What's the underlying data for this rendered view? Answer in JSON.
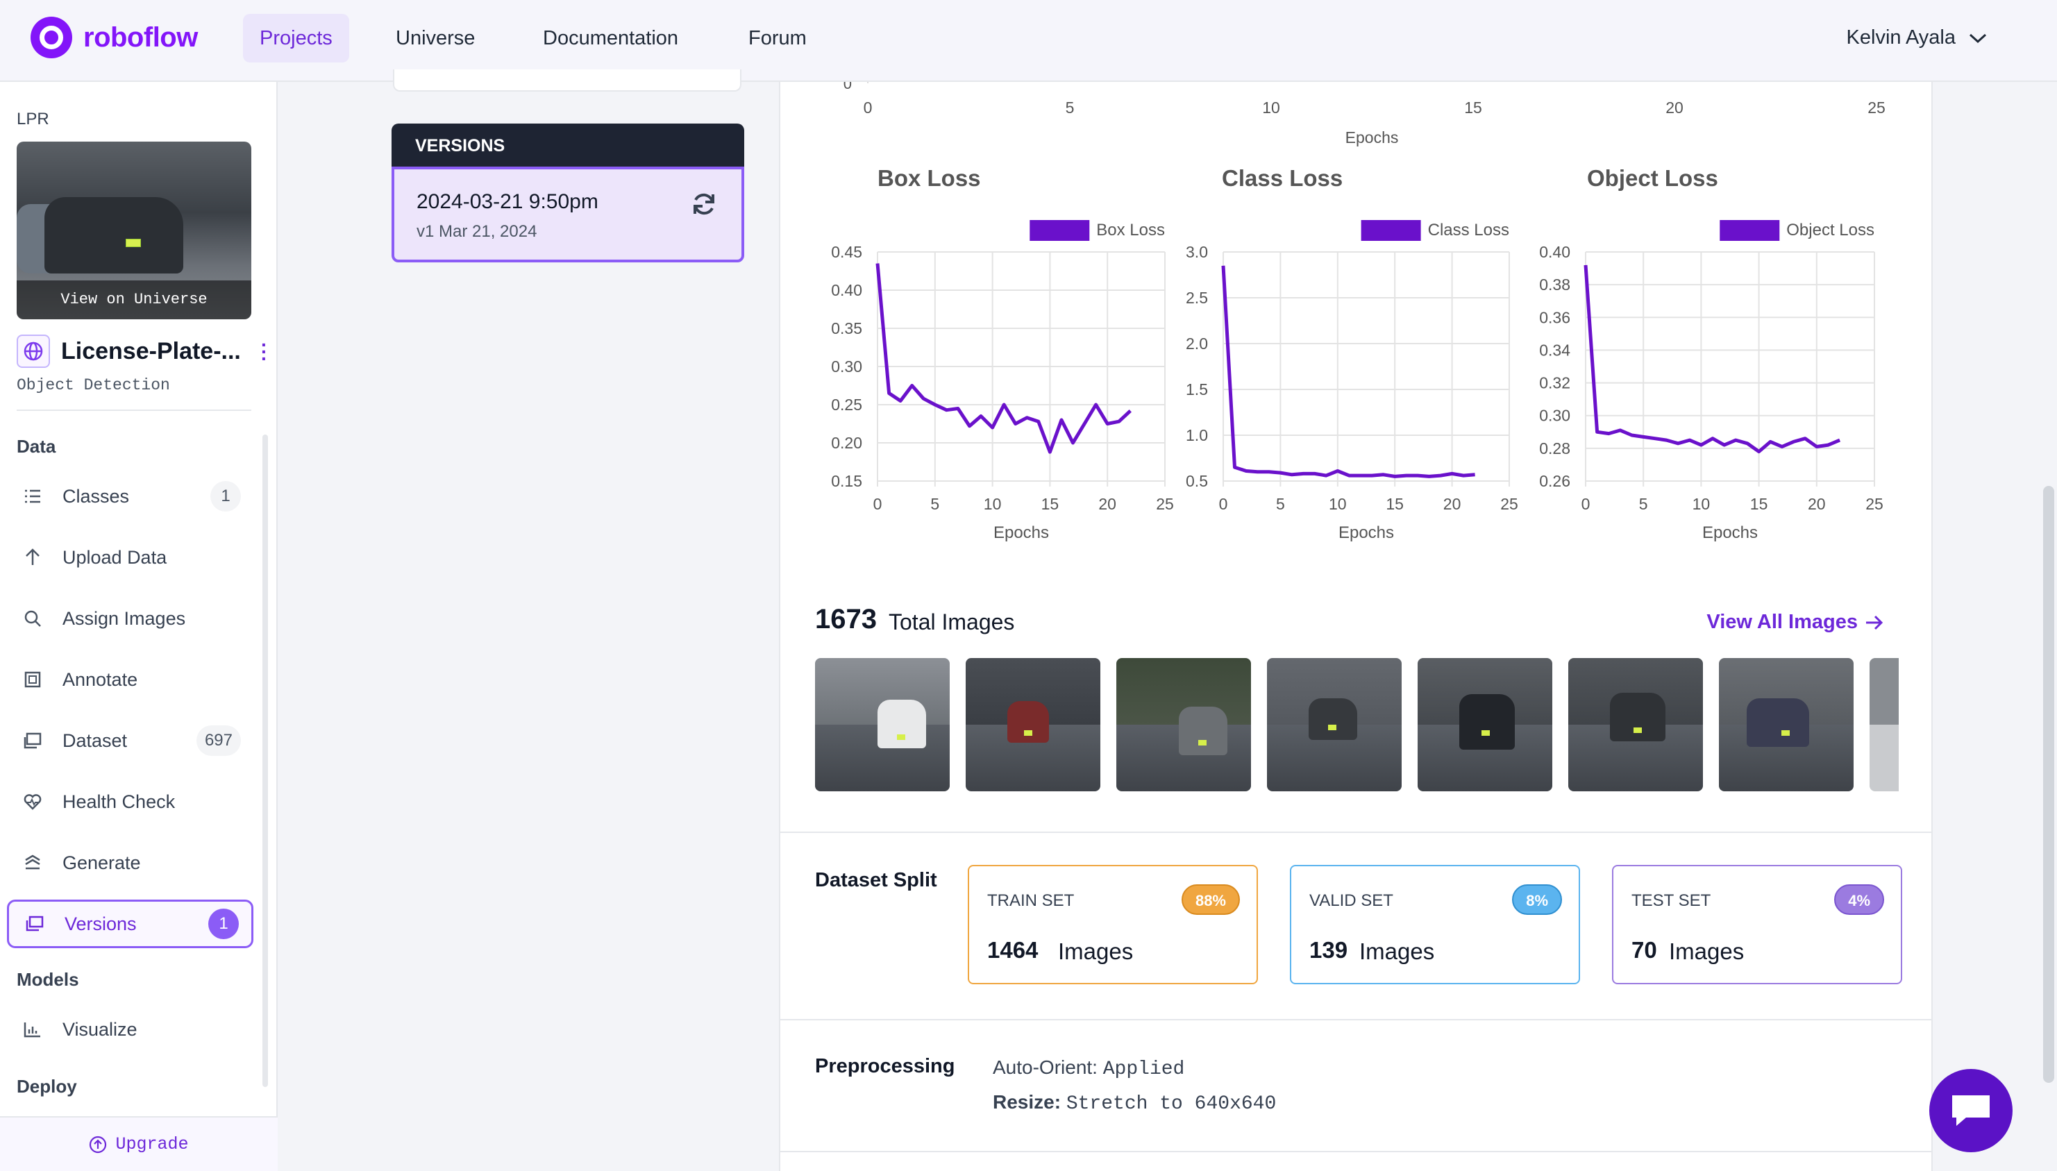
{
  "nav": {
    "brand": "roboflow",
    "links": [
      "Projects",
      "Universe",
      "Documentation",
      "Forum"
    ],
    "user": "Kelvin Ayala"
  },
  "sidebar": {
    "project_code": "LPR",
    "thumb_label": "View on Universe",
    "project_name": "License-Plate-...",
    "project_type": "Object Detection",
    "section_data": "Data",
    "items": [
      {
        "label": "Classes",
        "count": "1",
        "icon": "list-icon"
      },
      {
        "label": "Upload Data",
        "icon": "upload-icon"
      },
      {
        "label": "Assign Images",
        "icon": "search-icon"
      },
      {
        "label": "Annotate",
        "icon": "annotate-icon"
      },
      {
        "label": "Dataset",
        "count": "697",
        "icon": "dataset-icon"
      },
      {
        "label": "Health Check",
        "icon": "heart-pulse-icon"
      },
      {
        "label": "Generate",
        "icon": "generate-icon"
      },
      {
        "label": "Versions",
        "count": "1",
        "icon": "versions-icon"
      }
    ],
    "section_models": "Models",
    "visualize": "Visualize",
    "section_deploy": "Deploy",
    "upgrade": "Upgrade"
  },
  "versions": {
    "header": "VERSIONS",
    "name": "2024-03-21 9:50pm",
    "sub": "v1 Mar 21, 2024"
  },
  "top_chart": {
    "x_ticks": [
      "0",
      "5",
      "10",
      "15",
      "20",
      "25"
    ],
    "y_tick": "0",
    "xlabel": "Epochs"
  },
  "chart_data": [
    {
      "type": "line",
      "title": "Box Loss",
      "legend": "Box Loss",
      "xlabel": "Epochs",
      "ylim": [
        0.15,
        0.45
      ],
      "y_ticks": [
        "0.45",
        "0.40",
        "0.35",
        "0.30",
        "0.25",
        "0.20",
        "0.15"
      ],
      "y_tick_values": [
        0.45,
        0.4,
        0.35,
        0.3,
        0.25,
        0.2,
        0.15
      ],
      "x_ticks": [
        "0",
        "5",
        "10",
        "15",
        "20",
        "25"
      ],
      "xlim": [
        0,
        25
      ],
      "x": [
        0,
        1,
        2,
        3,
        4,
        5,
        6,
        7,
        8,
        9,
        10,
        11,
        12,
        13,
        14,
        15,
        16,
        17,
        18,
        19,
        20,
        21,
        22
      ],
      "y": [
        0.435,
        0.265,
        0.255,
        0.275,
        0.258,
        0.25,
        0.243,
        0.245,
        0.222,
        0.235,
        0.22,
        0.25,
        0.225,
        0.233,
        0.228,
        0.188,
        0.23,
        0.2,
        0.225,
        0.25,
        0.225,
        0.228,
        0.242
      ]
    },
    {
      "type": "line",
      "title": "Class Loss",
      "legend": "Class Loss",
      "xlabel": "Epochs",
      "ylim": [
        0.5,
        3.0
      ],
      "y_ticks": [
        "3.0",
        "2.5",
        "2.0",
        "1.5",
        "1.0",
        "0.5"
      ],
      "y_tick_values": [
        3.0,
        2.5,
        2.0,
        1.5,
        1.0,
        0.5
      ],
      "x_ticks": [
        "0",
        "5",
        "10",
        "15",
        "20",
        "25"
      ],
      "xlim": [
        0,
        25
      ],
      "x": [
        0,
        1,
        2,
        3,
        4,
        5,
        6,
        7,
        8,
        9,
        10,
        11,
        12,
        13,
        14,
        15,
        16,
        17,
        18,
        19,
        20,
        21,
        22
      ],
      "y": [
        2.85,
        0.65,
        0.61,
        0.6,
        0.6,
        0.59,
        0.57,
        0.58,
        0.58,
        0.56,
        0.61,
        0.56,
        0.56,
        0.56,
        0.57,
        0.55,
        0.56,
        0.56,
        0.55,
        0.56,
        0.58,
        0.56,
        0.57
      ]
    },
    {
      "type": "line",
      "title": "Object Loss",
      "legend": "Object Loss",
      "xlabel": "Epochs",
      "ylim": [
        0.26,
        0.4
      ],
      "y_ticks": [
        "0.40",
        "0.38",
        "0.36",
        "0.34",
        "0.32",
        "0.30",
        "0.28",
        "0.26"
      ],
      "y_tick_values": [
        0.4,
        0.38,
        0.36,
        0.34,
        0.32,
        0.3,
        0.28,
        0.26
      ],
      "x_ticks": [
        "0",
        "5",
        "10",
        "15",
        "20",
        "25"
      ],
      "xlim": [
        0,
        25
      ],
      "x": [
        0,
        1,
        2,
        3,
        4,
        5,
        6,
        7,
        8,
        9,
        10,
        11,
        12,
        13,
        14,
        15,
        16,
        17,
        18,
        19,
        20,
        21,
        22
      ],
      "y": [
        0.392,
        0.29,
        0.289,
        0.291,
        0.288,
        0.287,
        0.286,
        0.285,
        0.283,
        0.285,
        0.282,
        0.286,
        0.282,
        0.285,
        0.283,
        0.278,
        0.284,
        0.281,
        0.284,
        0.286,
        0.281,
        0.282,
        0.285
      ]
    }
  ],
  "images": {
    "count": "1673",
    "count_label": "Total Images",
    "view_all": "View All Images"
  },
  "split": {
    "title": "Dataset Split",
    "train": {
      "label": "TRAIN SET",
      "pct": "88%",
      "count": "1464",
      "unit": "Images",
      "color": "#f0a640"
    },
    "valid": {
      "label": "VALID SET",
      "pct": "8%",
      "count": "139",
      "unit": "Images",
      "color": "#5bb4ef"
    },
    "test": {
      "label": "TEST SET",
      "pct": "4%",
      "count": "70",
      "unit": "Images",
      "color": "#9b7be0"
    }
  },
  "preprocessing": {
    "title": "Preprocessing",
    "auto_orient_key": "Auto-Orient:",
    "auto_orient_val": "Applied",
    "resize_key": "Resize:",
    "resize_val": "Stretch to 640x640"
  },
  "colors": {
    "accent": "#6d28d9",
    "series": "#6a11cb"
  }
}
